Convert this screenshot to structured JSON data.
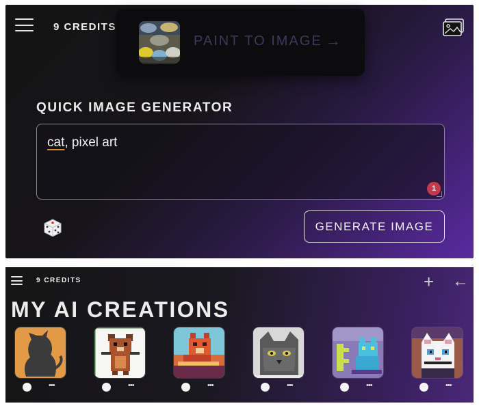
{
  "top_panel": {
    "credits_label": "9 CREDITS",
    "popup": {
      "label": "PAINT TO IMAGE",
      "arrow": "→",
      "thumb_icon": "paint-cans-icon"
    },
    "gallery_icon": "image-gallery-icon",
    "section_title": "QUICK IMAGE GENERATOR",
    "prompt": {
      "word1": "cat",
      "rest": ", pixel art",
      "badge_count": "1"
    },
    "dice_icon": "dice-icon",
    "generate_label": "GENERATE IMAGE"
  },
  "bottom_panel": {
    "credits_label": "9 CREDITS",
    "plus": "+",
    "back": "←",
    "title": "MY AI CREATIONS",
    "more": "•••",
    "cards": [
      {
        "name": "silhouette-cat",
        "icon": "cat-silhouette-image"
      },
      {
        "name": "pixel-bear",
        "icon": "pixel-bear-image"
      },
      {
        "name": "pixel-fox-cat",
        "icon": "pixel-fox-image"
      },
      {
        "name": "grey-cat",
        "icon": "grey-cat-image"
      },
      {
        "name": "blue-pixel-cat",
        "icon": "blue-cat-image"
      },
      {
        "name": "white-pixel-cat",
        "icon": "white-cat-image"
      }
    ]
  },
  "colors": {
    "accent_purple": "#5a2aa0",
    "badge_red": "#c9374a",
    "spell_underline": "#d98b2a"
  }
}
